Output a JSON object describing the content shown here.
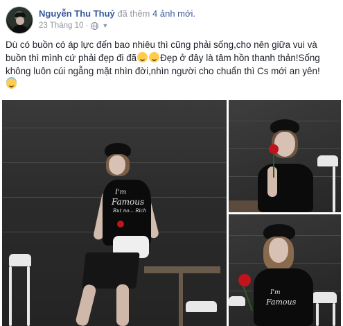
{
  "post": {
    "author": "Nguyễn Thu Thuỷ",
    "action_prefix": "đã thêm",
    "action_count": "4 ảnh mới.",
    "timestamp": "23 Tháng 10 ·",
    "privacy_icon": "globe-icon",
    "text_lines": [
      "Dù có buồn có áp lực đến bao nhiêu thì cũng phải sống,cho nên giữa vui và",
      "buồn thì mình cứ phải đẹp đi đã",
      "Đẹp ở đây là tâm hồn thanh thản!Sống",
      "không luôn cúi ngẫng mặt nhìn đời,nhìn người cho chuẩn thì Cs mới an yên!"
    ],
    "emojis": [
      "winking-tongue-emoji",
      "smiling-emoji",
      "halo-emoji"
    ],
    "shirt_print": [
      "I'm",
      "Famous",
      "But no... Rich"
    ]
  },
  "colors": {
    "author": "#365899",
    "meta": "#90949c",
    "text": "#1d2129"
  }
}
